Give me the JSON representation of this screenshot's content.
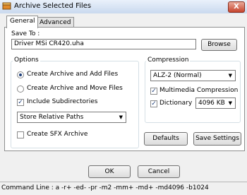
{
  "window": {
    "title": "Archive Selected Files",
    "close_glyph": "X"
  },
  "tabs": [
    {
      "label": "General"
    },
    {
      "label": "Advanced"
    }
  ],
  "save_to": {
    "label": "Save To :",
    "value": "Driver MSi CR420.uha",
    "browse_label": "Browse"
  },
  "options": {
    "title": "Options",
    "radio_add": "Create Archive and Add Files",
    "radio_move": "Create Archive and Move Files",
    "include_subdirs": "Include Subdirectories",
    "include_subdirs_checked": true,
    "paths_value": "Store Relative Paths",
    "sfx_label": "Create SFX Archive",
    "sfx_checked": false,
    "selected_mode": "add"
  },
  "compression": {
    "title": "Compression",
    "method_value": "ALZ-2 (Normal)",
    "multimedia_label": "Multimedia Compression",
    "multimedia_checked": true,
    "dictionary_label": "Dictionary",
    "dictionary_checked": true,
    "dictionary_value": "4096 KB"
  },
  "buttons": {
    "defaults": "Defaults",
    "save_settings": "Save Settings",
    "ok": "OK",
    "cancel": "Cancel"
  },
  "status": {
    "command_line": "Command Line : a -r+ -ed- -pr -m2 -mm+ -md+ -md4096 -b1024"
  }
}
